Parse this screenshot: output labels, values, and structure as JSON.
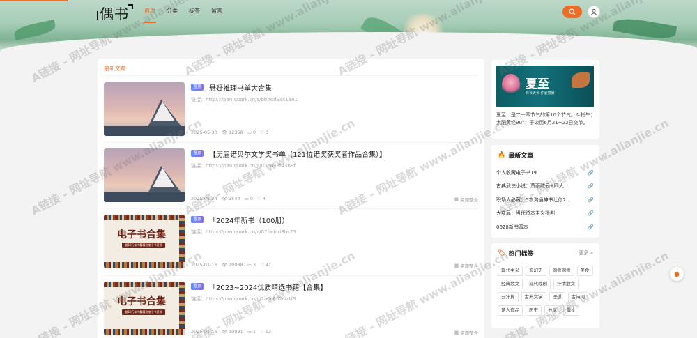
{
  "header": {
    "logo": "偶书",
    "nav": [
      {
        "label": "首页",
        "active": true
      },
      {
        "label": "分类",
        "active": false
      },
      {
        "label": "标签",
        "active": false
      },
      {
        "label": "留言",
        "active": false
      }
    ],
    "accent": "#f06b24"
  },
  "main": {
    "section_title": "最新文章",
    "posts": [
      {
        "thumb": "mountain",
        "badge": "置顶",
        "title": "悬疑推理书单大合集",
        "link": "链接：https://pan.quark.cn/s/bb4dd9ac1a81",
        "date": "2025-05-30",
        "views": "12358",
        "comments": "0",
        "likes": "0",
        "category": ""
      },
      {
        "thumb": "mountain",
        "badge": "置顶",
        "title": "【历届诺贝尔文学奖书单（121位诺奖获奖者作品合集）】",
        "link": "链接：https://pan.quark.cn/s/03e433f43b8f",
        "date": "2025-05-24",
        "views": "1544",
        "comments": "0",
        "likes": "4",
        "category": "资源整合"
      },
      {
        "thumb": "books",
        "badge": "置顶",
        "title": "「2024年新书（100册）",
        "link": "链接：https://pan.quark.cn/s/07fadad8bc23",
        "date": "2025-01-16",
        "views": "20088",
        "comments": "3",
        "likes": "41",
        "category": "资源整合"
      },
      {
        "thumb": "books",
        "badge": "置顶",
        "title": "「2023~2024优质精选书籍【合集】",
        "link": "链接：https://pan.quark.cn/s/2a6c662cb1f3",
        "date": "2025-01-16",
        "views": "10031",
        "comments": "1",
        "likes": "12",
        "category": "资源整合"
      }
    ],
    "books_thumb": {
      "title": "电子书合集",
      "subtitle": "超10万本书籍精选电子书资源"
    }
  },
  "sidebar": {
    "promo": {
      "image_title": "夏至",
      "image_subtitle": "日长天长  仲夏丽景",
      "text": "夏至，是二十四节气的第10个节气。斗指午；太阳黄经90°；于公历6月21~22日交节。"
    },
    "latest": {
      "title": "最新文章",
      "items": [
        "个人收藏电子书19",
        "古典武侠小说：萧雨疏云+四大...",
        "职场人必藏：5本沟通神书让你2...",
        "大变局：当代资本主义批判",
        "0628新书四本"
      ]
    },
    "tags": {
      "title": "热门标签",
      "more": "更多 »",
      "items": [
        "现代主义",
        "玄幻史",
        "网盘网盘",
        "美食",
        "经典散文",
        "现代戏剧",
        "抒情散文",
        "云计算",
        "古典文学",
        "理想",
        "古诗词",
        "诗人作品",
        "历史",
        "分享",
        "散文"
      ]
    }
  },
  "watermark": "A链接 - 网址导航 www.alianjie.cn"
}
